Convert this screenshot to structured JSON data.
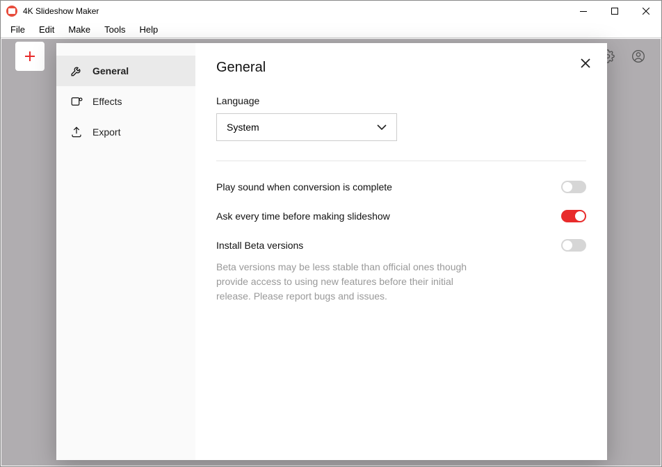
{
  "window": {
    "title": "4K Slideshow Maker"
  },
  "menu": {
    "file": "File",
    "edit": "Edit",
    "make": "Make",
    "tools": "Tools",
    "help": "Help"
  },
  "settings": {
    "tabs": {
      "general": "General",
      "effects": "Effects",
      "export": "Export"
    },
    "pane_title": "General",
    "language": {
      "label": "Language",
      "value": "System"
    },
    "opts": {
      "play_sound": "Play sound when conversion is complete",
      "ask_before": "Ask every time before making slideshow",
      "install_beta": "Install Beta versions",
      "beta_desc": "Beta versions may be less stable than official ones though provide access to using new features before their initial release. Please report bugs and issues."
    },
    "toggles": {
      "play_sound": false,
      "ask_before": true,
      "install_beta": false
    }
  }
}
